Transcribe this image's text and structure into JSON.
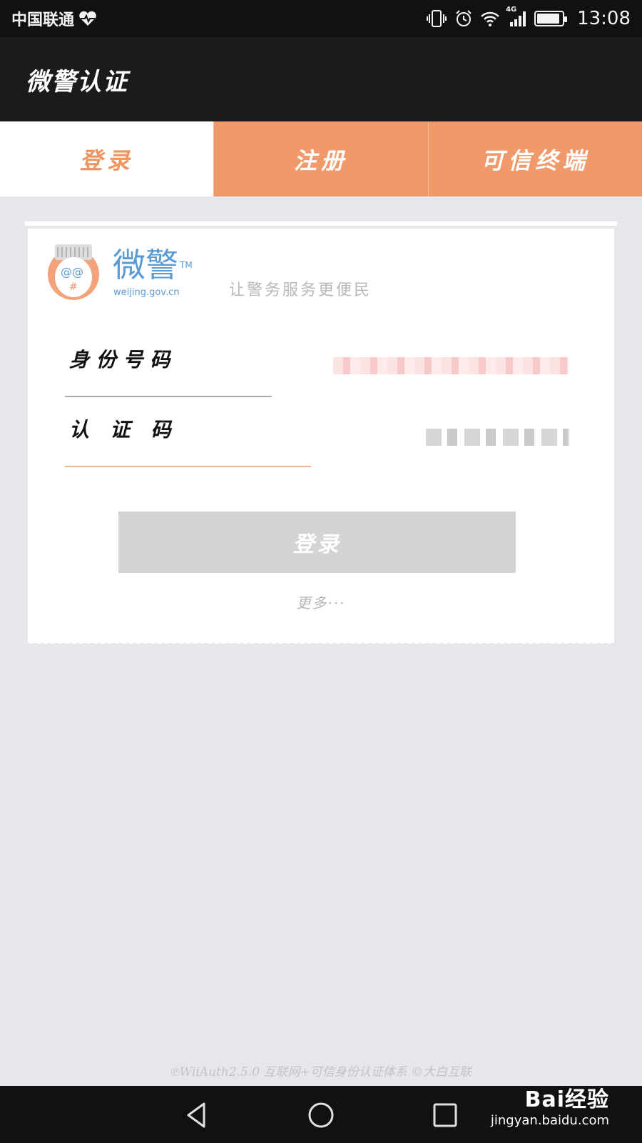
{
  "status_bar": {
    "carrier": "中国联通",
    "time": "13:08",
    "network": "4G",
    "icons": [
      "heartbeat-icon",
      "vibrate-icon",
      "alarm-icon",
      "wifi-icon",
      "signal-icon",
      "battery-icon"
    ]
  },
  "app_bar": {
    "title": "微警认证"
  },
  "tabs": [
    {
      "label": "登录",
      "active": true
    },
    {
      "label": "注册",
      "active": false
    },
    {
      "label": "可信终端",
      "active": false
    }
  ],
  "brand": {
    "logo_text": "微警",
    "trademark": "TM",
    "url": "weijing.gov.cn",
    "slogan": "让警务服务更便民"
  },
  "form": {
    "id_label": "身 份 号 码",
    "code_label": "认   证   码",
    "login_button": "登录",
    "more_link": "更多···"
  },
  "footer": {
    "text": "℗WiiAuth2.5.0 互联网+可信身份认证体系 ©大白互联"
  },
  "watermark": {
    "main": "Bai经验",
    "sub": "jingyan.baidu.com"
  },
  "colors": {
    "accent": "#f09a6c",
    "accent_text": "#ee9561",
    "app_bar": "#1b1b1b",
    "background": "#e6e7eb",
    "logo_blue": "#5a9bd5"
  }
}
